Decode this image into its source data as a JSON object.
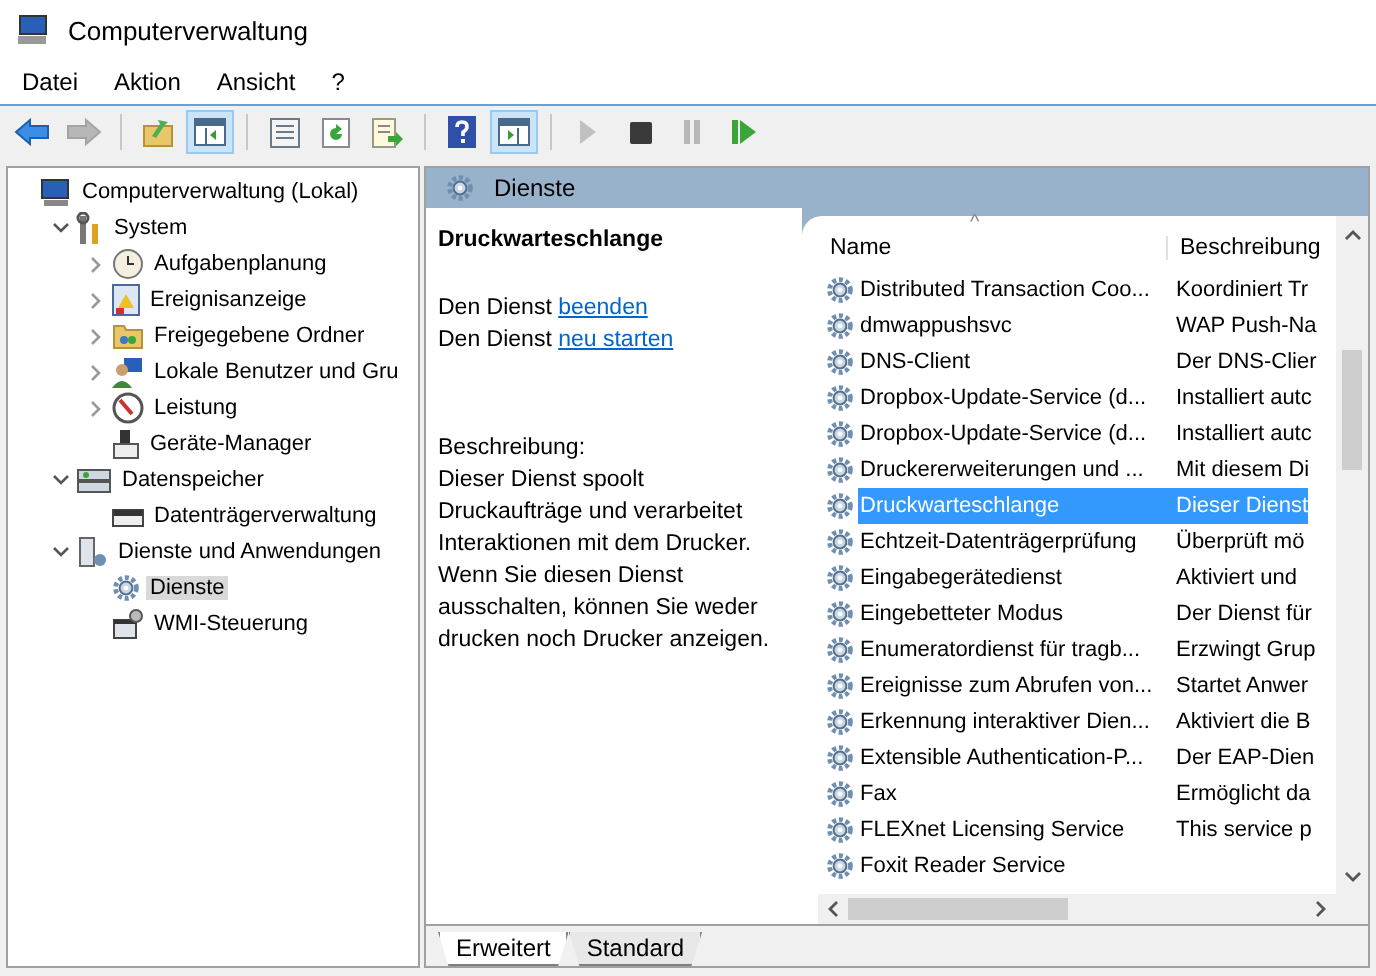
{
  "window": {
    "title": "Computerverwaltung"
  },
  "menu": [
    "Datei",
    "Aktion",
    "Ansicht",
    "?"
  ],
  "toolbar": [
    {
      "kind": "back",
      "pressed": false,
      "disabled": false
    },
    {
      "kind": "forward",
      "pressed": false,
      "disabled": true
    },
    {
      "kind": "up",
      "pressed": false,
      "disabled": false
    },
    {
      "kind": "tree",
      "pressed": true,
      "disabled": false
    },
    {
      "kind": "properties",
      "pressed": false,
      "disabled": false
    },
    {
      "kind": "refresh",
      "pressed": false,
      "disabled": false
    },
    {
      "kind": "export",
      "pressed": false,
      "disabled": false
    },
    {
      "kind": "help",
      "pressed": false,
      "disabled": false
    },
    {
      "kind": "actionpane",
      "pressed": true,
      "disabled": false
    },
    {
      "kind": "play",
      "pressed": false,
      "disabled": true
    },
    {
      "kind": "stop",
      "pressed": false,
      "disabled": false
    },
    {
      "kind": "pause",
      "pressed": false,
      "disabled": true
    },
    {
      "kind": "resume",
      "pressed": false,
      "disabled": false
    }
  ],
  "tree": [
    {
      "label": "Computerverwaltung (Lokal)",
      "selected": false,
      "children": [
        {
          "label": "System",
          "expanded": true,
          "selected": false,
          "children": [
            {
              "label": "Aufgabenplanung",
              "expanded": false,
              "selected": false
            },
            {
              "label": "Ereignisanzeige",
              "expanded": false,
              "selected": false
            },
            {
              "label": "Freigegebene Ordner",
              "expanded": false,
              "selected": false
            },
            {
              "label": "Lokale Benutzer und Gru",
              "expanded": false,
              "selected": false
            },
            {
              "label": "Leistung",
              "expanded": false,
              "selected": false
            },
            {
              "label": "Geräte-Manager",
              "selected": false
            }
          ]
        },
        {
          "label": "Datenspeicher",
          "expanded": true,
          "selected": false,
          "children": [
            {
              "label": "Datenträgerverwaltung",
              "selected": false
            }
          ]
        },
        {
          "label": "Dienste und Anwendungen",
          "expanded": true,
          "selected": false,
          "children": [
            {
              "label": "Dienste",
              "selected": true
            },
            {
              "label": "WMI-Steuerung",
              "selected": false
            }
          ]
        }
      ]
    }
  ],
  "pane_title": "Dienste",
  "detail": {
    "service": "Druckwarteschlange",
    "actions": [
      {
        "prefix": "Den Dienst",
        "link": "beenden"
      },
      {
        "prefix": "Den Dienst",
        "link": "neu starten"
      }
    ],
    "description_label": "Beschreibung:",
    "description": "Dieser Dienst spoolt Druckaufträge und verarbeitet Interaktionen mit dem Drucker. Wenn Sie diesen Dienst ausschalten, können Sie weder drucken noch Drucker anzeigen."
  },
  "table": {
    "sort_indicator": "^",
    "columns": [
      "Name",
      "Beschreibung"
    ],
    "rows": [
      {
        "name": "Distributed Transaction Coo...",
        "description": "Koordiniert Tr",
        "selected": false
      },
      {
        "name": "dmwappushsvc",
        "description": "WAP Push-Na",
        "selected": false
      },
      {
        "name": "DNS-Client",
        "description": "Der DNS-Clier",
        "selected": false
      },
      {
        "name": "Dropbox-Update-Service (d...",
        "description": "Installiert autc",
        "selected": false
      },
      {
        "name": "Dropbox-Update-Service (d...",
        "description": "Installiert autc",
        "selected": false
      },
      {
        "name": "Druckererweiterungen und ...",
        "description": "Mit diesem Di",
        "selected": false
      },
      {
        "name": "Druckwarteschlange",
        "description": "Dieser Dienst",
        "selected": true
      },
      {
        "name": "Echtzeit-Datenträgerprüfung",
        "description": "Überprüft mö",
        "selected": false
      },
      {
        "name": "Eingabegerätedienst",
        "description": "Aktiviert und",
        "selected": false
      },
      {
        "name": "Eingebetteter Modus",
        "description": "Der Dienst für",
        "selected": false
      },
      {
        "name": "Enumeratordienst für tragb...",
        "description": "Erzwingt Grup",
        "selected": false
      },
      {
        "name": "Ereignisse zum Abrufen von...",
        "description": "Startet Anwer",
        "selected": false
      },
      {
        "name": "Erkennung interaktiver Dien...",
        "description": "Aktiviert die B",
        "selected": false
      },
      {
        "name": "Extensible Authentication-P...",
        "description": "Der EAP-Dien",
        "selected": false
      },
      {
        "name": "Fax",
        "description": "Ermöglicht da",
        "selected": false
      },
      {
        "name": "FLEXnet Licensing Service",
        "description": "This service p",
        "selected": false
      },
      {
        "name": "Foxit Reader Service",
        "selected": false
      }
    ]
  },
  "tabs": [
    {
      "label": "Erweitert",
      "selected": true
    },
    {
      "label": "Standard",
      "selected": false
    }
  ]
}
